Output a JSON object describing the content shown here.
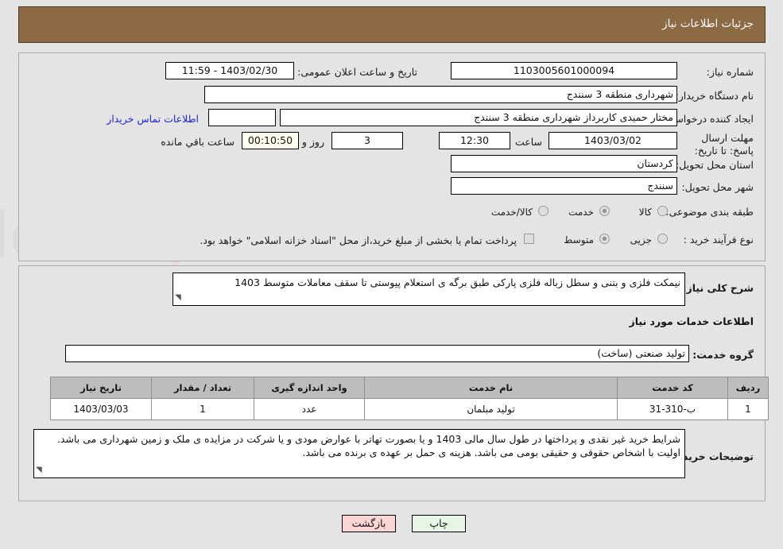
{
  "header": {
    "title": "جزئیات اطلاعات نیاز"
  },
  "form": {
    "need_number_label": "شماره نیاز:",
    "need_number_value": "1103005601000094",
    "announce_datetime_label": "تاریخ و ساعت اعلان عمومی:",
    "announce_datetime_value": "1403/02/30 - 11:59",
    "buyer_org_label": "نام دستگاه خریدار:",
    "buyer_org_value": "شهرداری منطقه 3 سنندج",
    "creator_label": "ایجاد کننده درخواست:",
    "creator_value": "مختار حمیدی کاربرداز شهرداری منطقه 3 سنندج",
    "creator_extra_value": "",
    "contact_link": "اطلاعات تماس خریدار",
    "deadline_label": "مهلت ارسال پاسخ: تا تاریخ:",
    "deadline_date": "1403/03/02",
    "deadline_time_label": "ساعت",
    "deadline_time": "12:30",
    "remaining_days": "3",
    "days_label": "روز و",
    "remaining_clock": "00:10:50",
    "remaining_suffix": "ساعت باقي مانده",
    "province_label": "استان محل تحویل:",
    "province_value": "کردستان",
    "city_label": "شهر محل تحویل:",
    "city_value": "سنندج",
    "category_label": "طبقه بندی موضوعی:",
    "category_options": [
      {
        "label": "کالا",
        "selected": false
      },
      {
        "label": "خدمت",
        "selected": true
      },
      {
        "label": "کالا/خدمت",
        "selected": false
      }
    ],
    "process_label": "نوع فرآیند خرید :",
    "process_options": [
      {
        "label": "جزیی",
        "selected": false
      },
      {
        "label": "متوسط",
        "selected": true
      }
    ],
    "treasury_checkbox_checked": false,
    "treasury_checkbox_label": "پرداخت تمام یا بخشی از مبلغ خرید،از محل \"اسناد خزانه اسلامی\" خواهد بود."
  },
  "need_description": {
    "label": "شرح کلی نیاز:",
    "value": "نیمکت فلزی و بتنی  و سطل زباله فلزی پارکی طبق برگه ی استعلام پیوستی تا سقف معاملات متوسط 1403"
  },
  "services_section": {
    "heading": "اطلاعات خدمات مورد نیاز",
    "service_group_label": "گروه خدمت:",
    "service_group_value": "تولید صنعتی (ساخت)",
    "table": {
      "headers": [
        "ردیف",
        "کد خدمت",
        "نام خدمت",
        "واحد اندازه گیری",
        "تعداد / مقدار",
        "تاریخ نیاز"
      ],
      "rows": [
        {
          "row_no": "1",
          "service_code": "ب-310-31",
          "service_name": "تولید مبلمان",
          "unit": "عدد",
          "quantity": "1",
          "need_date": "1403/03/03"
        }
      ]
    }
  },
  "buyer_notes": {
    "label": "توضیحات خریدار:",
    "value": "شرایط خرید غیر نقدی و پرداختها در طول سال مالی 1403 و یا  بصورت تهاتر با عوارض مودی و یا شرکت در مزایده ی ملک و زمین شهرداری می باشد. اولیت با اشخاص حقوقی و حقیقی  بومی می باشد. هزینه ی حمل بر عهده ی برنده می باشد."
  },
  "buttons": {
    "print": "چاپ",
    "back": "بازگشت"
  },
  "colors": {
    "header_bar": "#8c6b44",
    "panel_bg": "#e4e4e4",
    "table_header": "#bdbdbd",
    "link": "#2222cc",
    "print_btn": "#e8f6e8",
    "back_btn": "#fbd5d5",
    "countdown_bg": "#fffff0"
  },
  "watermark": {
    "text": "AriaTender.net"
  }
}
